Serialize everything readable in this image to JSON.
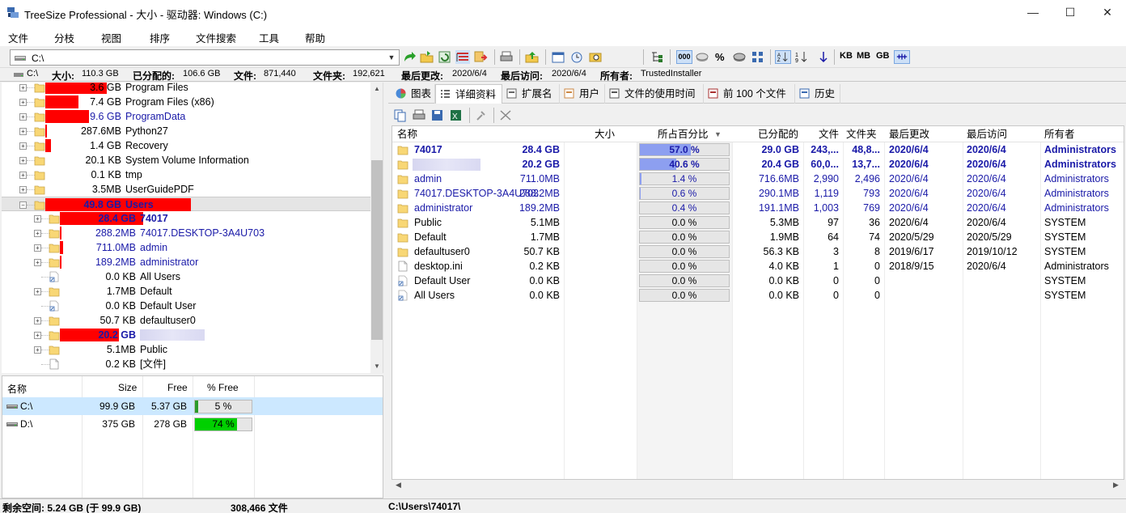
{
  "window": {
    "title": "TreeSize Professional - 大小 - 驱动器: Windows (C:)",
    "controls": {
      "minimize": "—",
      "maximize": "☐",
      "close": "✕"
    }
  },
  "menu": [
    "文件",
    "分枝",
    "视图",
    "排序",
    "文件搜索",
    "工具",
    "帮助"
  ],
  "toolbar": {
    "path": "C:\\",
    "unit_labels": [
      "KB",
      "MB",
      "GB"
    ],
    "percent_label": "%"
  },
  "info": {
    "drive": "C:\\",
    "size_label": "大小:",
    "size_value": "110.3 GB",
    "allocated_label": "已分配的:",
    "allocated_value": "106.6 GB",
    "files_label": "文件:",
    "files_value": "871,440",
    "folders_label": "文件夹:",
    "folders_value": "192,621",
    "last_change_label": "最后更改:",
    "last_change_value": "2020/6/4",
    "last_access_label": "最后访问:",
    "last_access_value": "2020/6/4",
    "owner_label": "所有者:",
    "owner_value": "TrustedInstaller"
  },
  "tree": [
    {
      "level": 1,
      "size": "3.6 GB",
      "name": "Program Files",
      "bar": 0.42,
      "blue": false,
      "bold": false,
      "exp": true,
      "icon": "folder"
    },
    {
      "level": 1,
      "size": "7.4 GB",
      "name": "Program Files (x86)",
      "bar": 0.23,
      "blue": false,
      "bold": false,
      "exp": true,
      "icon": "folder"
    },
    {
      "level": 1,
      "size": "9.6 GB",
      "name": "ProgramData",
      "bar": 0.3,
      "blue": true,
      "bold": false,
      "exp": true,
      "icon": "folder"
    },
    {
      "level": 1,
      "size": "287.6MB",
      "name": "Python27",
      "bar": 0.01,
      "blue": false,
      "bold": false,
      "exp": true,
      "icon": "folder"
    },
    {
      "level": 1,
      "size": "1.4 GB",
      "name": "Recovery",
      "bar": 0.04,
      "blue": false,
      "bold": false,
      "exp": true,
      "icon": "folder"
    },
    {
      "level": 1,
      "size": "20.1 KB",
      "name": "System Volume Information",
      "bar": 0,
      "blue": false,
      "bold": false,
      "exp": true,
      "icon": "folder"
    },
    {
      "level": 1,
      "size": "0.1 KB",
      "name": "tmp",
      "bar": 0,
      "blue": false,
      "bold": false,
      "exp": true,
      "icon": "folder"
    },
    {
      "level": 1,
      "size": "3.5MB",
      "name": "UserGuidePDF",
      "bar": 0,
      "blue": false,
      "bold": false,
      "exp": true,
      "icon": "folder"
    },
    {
      "level": 1,
      "size": "49.8 GB",
      "name": "Users",
      "bar": 1,
      "blue": true,
      "bold": true,
      "exp": false,
      "icon": "folder",
      "selected": true
    },
    {
      "level": 2,
      "size": "28.4 GB",
      "name": "74017",
      "bar": 0.57,
      "blue": true,
      "bold": true,
      "exp": true,
      "icon": "folder"
    },
    {
      "level": 2,
      "size": "288.2MB",
      "name": "74017.DESKTOP-3A4U703",
      "bar": 0.01,
      "blue": true,
      "bold": false,
      "exp": true,
      "icon": "folder"
    },
    {
      "level": 2,
      "size": "711.0MB",
      "name": "admin",
      "bar": 0.02,
      "blue": true,
      "bold": false,
      "exp": true,
      "icon": "folder"
    },
    {
      "level": 2,
      "size": "189.2MB",
      "name": "administrator",
      "bar": 0.01,
      "blue": true,
      "bold": false,
      "exp": true,
      "icon": "folder"
    },
    {
      "level": 2,
      "size": "0.0 KB",
      "name": "All Users",
      "bar": 0,
      "blue": false,
      "bold": false,
      "exp": false,
      "icon": "link"
    },
    {
      "level": 2,
      "size": "1.7MB",
      "name": "Default",
      "bar": 0,
      "blue": false,
      "bold": false,
      "exp": true,
      "icon": "folder"
    },
    {
      "level": 2,
      "size": "0.0 KB",
      "name": "Default User",
      "bar": 0,
      "blue": false,
      "bold": false,
      "exp": false,
      "icon": "link"
    },
    {
      "level": 2,
      "size": "50.7 KB",
      "name": "defaultuser0",
      "bar": 0,
      "blue": false,
      "bold": false,
      "exp": true,
      "icon": "folder"
    },
    {
      "level": 2,
      "size": "20.2 GB",
      "name": "",
      "bar": 0.406,
      "blue": true,
      "bold": true,
      "exp": true,
      "icon": "folder",
      "redacted": true
    },
    {
      "level": 2,
      "size": "5.1MB",
      "name": "Public",
      "bar": 0,
      "blue": false,
      "bold": false,
      "exp": true,
      "icon": "folder"
    },
    {
      "level": 2,
      "size": "0.2 KB",
      "name": "[文件]",
      "bar": 0,
      "blue": false,
      "bold": false,
      "exp": false,
      "icon": "file"
    }
  ],
  "drives": {
    "headers": [
      "名称",
      "Size",
      "Free",
      "% Free"
    ],
    "rows": [
      {
        "name": "C:\\",
        "size": "99.9 GB",
        "free": "5.37 GB",
        "pct_label": "5 %",
        "pct": 0.05,
        "color": "#2a9b2a",
        "selected": true
      },
      {
        "name": "D:\\",
        "size": "375 GB",
        "free": "278 GB",
        "pct_label": "74 %",
        "pct": 0.74,
        "color": "#00d000",
        "selected": false
      }
    ]
  },
  "tabs": [
    "图表",
    "详细资料",
    "扩展名",
    "用户",
    "文件的使用时间",
    "前 100 个文件",
    "历史"
  ],
  "active_tab": 1,
  "grid": {
    "headers": [
      "名称",
      "大小",
      "所占百分比",
      "已分配的",
      "文件",
      "文件夹",
      "最后更改",
      "最后访问",
      "所有者"
    ],
    "rows": [
      {
        "name": "74017",
        "size": "28.4 GB",
        "pct": 0.57,
        "pct_label": "57.0 %",
        "alloc": "29.0 GB",
        "files": "243,...",
        "folders": "48,8...",
        "changed": "2020/6/4",
        "accessed": "2020/6/4",
        "owner": "Administrators",
        "style": "bluebold",
        "icon": "folder"
      },
      {
        "name": "",
        "size": "20.2 GB",
        "pct": 0.406,
        "pct_label": "40.6 %",
        "alloc": "20.4 GB",
        "files": "60,0...",
        "folders": "13,7...",
        "changed": "2020/6/4",
        "accessed": "2020/6/4",
        "owner": "Administrators",
        "style": "bluebold",
        "icon": "folder",
        "redacted": true
      },
      {
        "name": "admin",
        "size": "711.0MB",
        "pct": 0.014,
        "pct_label": "1.4 %",
        "alloc": "716.6MB",
        "files": "2,990",
        "folders": "2,496",
        "changed": "2020/6/4",
        "accessed": "2020/6/4",
        "owner": "Administrators",
        "style": "blue",
        "icon": "folder"
      },
      {
        "name": "74017.DESKTOP-3A4U703",
        "size": "288.2MB",
        "pct": 0.006,
        "pct_label": "0.6 %",
        "alloc": "290.1MB",
        "files": "1,119",
        "folders": "793",
        "changed": "2020/6/4",
        "accessed": "2020/6/4",
        "owner": "Administrators",
        "style": "blue",
        "icon": "folder"
      },
      {
        "name": "administrator",
        "size": "189.2MB",
        "pct": 0.004,
        "pct_label": "0.4 %",
        "alloc": "191.1MB",
        "files": "1,003",
        "folders": "769",
        "changed": "2020/6/4",
        "accessed": "2020/6/4",
        "owner": "Administrators",
        "style": "blue",
        "icon": "folder"
      },
      {
        "name": "Public",
        "size": "5.1MB",
        "pct": 0,
        "pct_label": "0.0 %",
        "alloc": "5.3MB",
        "files": "97",
        "folders": "36",
        "changed": "2020/6/4",
        "accessed": "2020/6/4",
        "owner": "SYSTEM",
        "style": "plain",
        "icon": "folder"
      },
      {
        "name": "Default",
        "size": "1.7MB",
        "pct": 0,
        "pct_label": "0.0 %",
        "alloc": "1.9MB",
        "files": "64",
        "folders": "74",
        "changed": "2020/5/29",
        "accessed": "2020/5/29",
        "owner": "SYSTEM",
        "style": "plain",
        "icon": "folder"
      },
      {
        "name": "defaultuser0",
        "size": "50.7 KB",
        "pct": 0,
        "pct_label": "0.0 %",
        "alloc": "56.3 KB",
        "files": "3",
        "folders": "8",
        "changed": "2019/6/17",
        "accessed": "2019/10/12",
        "owner": "SYSTEM",
        "style": "plain",
        "icon": "folder"
      },
      {
        "name": "desktop.ini",
        "size": "0.2 KB",
        "pct": 0,
        "pct_label": "0.0 %",
        "alloc": "4.0 KB",
        "files": "1",
        "folders": "0",
        "changed": "2018/9/15",
        "accessed": "2020/6/4",
        "owner": "Administrators",
        "style": "plain",
        "icon": "file"
      },
      {
        "name": "Default User",
        "size": "0.0 KB",
        "pct": 0,
        "pct_label": "0.0 %",
        "alloc": "0.0 KB",
        "files": "0",
        "folders": "0",
        "changed": "",
        "accessed": "",
        "owner": "SYSTEM",
        "style": "plain",
        "icon": "link"
      },
      {
        "name": "All Users",
        "size": "0.0 KB",
        "pct": 0,
        "pct_label": "0.0 %",
        "alloc": "0.0 KB",
        "files": "0",
        "folders": "0",
        "changed": "",
        "accessed": "",
        "owner": "SYSTEM",
        "style": "plain",
        "icon": "link"
      }
    ]
  },
  "status": {
    "free_space": "剩余空间: 5.24 GB  (于 99.9 GB)",
    "files": "308,466  文件",
    "path": "C:\\Users\\74017\\"
  },
  "colors": {
    "accent": "#1a1aa8",
    "bar": "#ff0000",
    "pct_fill": "#8d9ff0",
    "folder": "#f8d775"
  }
}
